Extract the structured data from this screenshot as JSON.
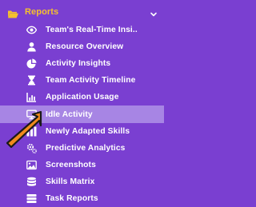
{
  "colors": {
    "background": "#7a3fd1",
    "active_row": "#a785e4",
    "header_text": "#f6c12c",
    "arrow": "#f08a1d"
  },
  "header": {
    "label": "Reports",
    "icon": "folder-open-icon",
    "toggle_icon": "chevron-down-icon"
  },
  "items": [
    {
      "label": "Team's Real-Time Insi...",
      "icon": "eye-icon"
    },
    {
      "label": "Resource Overview",
      "icon": "user-icon"
    },
    {
      "label": "Activity Insights",
      "icon": "pie-chart-icon"
    },
    {
      "label": "Team Activity Timeline",
      "icon": "hourglass-icon"
    },
    {
      "label": "Application Usage",
      "icon": "bar-chart-icon"
    },
    {
      "label": "Idle Activity",
      "icon": "monitor-icon"
    },
    {
      "label": "Newly Adapted Skills",
      "icon": "bars-icon"
    },
    {
      "label": "Predictive Analytics",
      "icon": "gears-icon"
    },
    {
      "label": "Screenshots",
      "icon": "image-icon"
    },
    {
      "label": "Skills Matrix",
      "icon": "database-icon"
    },
    {
      "label": "Task Reports",
      "icon": "list-icon"
    }
  ],
  "active_item": "Idle Activity",
  "annotation": {
    "icon": "arrow-pointer-icon"
  }
}
